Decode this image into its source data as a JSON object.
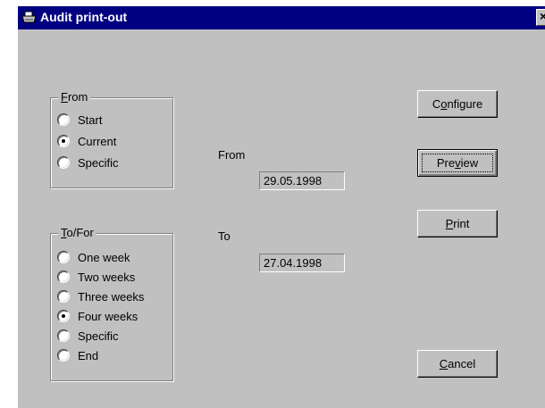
{
  "window": {
    "title": "Audit print-out",
    "icon": "printer-icon",
    "close_glyph": "×"
  },
  "from_group": {
    "legend_accel": "F",
    "legend_rest": "rom",
    "options": [
      {
        "label": "Start",
        "checked": false
      },
      {
        "label": "Current",
        "checked": true
      },
      {
        "label": "Specific",
        "checked": false
      }
    ]
  },
  "to_group": {
    "legend_accel": "T",
    "legend_rest": "o/For",
    "options": [
      {
        "label": "One week",
        "checked": false
      },
      {
        "label": "Two weeks",
        "checked": false
      },
      {
        "label": "Three weeks",
        "checked": false
      },
      {
        "label": "Four weeks",
        "checked": true
      },
      {
        "label": "Specific",
        "checked": false
      },
      {
        "label": "End",
        "checked": false
      }
    ]
  },
  "dates": {
    "from_label": "From",
    "from_value": "29.05.1998",
    "to_label": "To",
    "to_value": "27.04.1998"
  },
  "buttons": {
    "configure": {
      "pre": "C",
      "accel": "o",
      "post": "nfigure"
    },
    "preview": {
      "pre": "Pre",
      "accel": "v",
      "post": "iew"
    },
    "print": {
      "pre": "",
      "accel": "P",
      "post": "rint"
    },
    "cancel": {
      "pre": "",
      "accel": "C",
      "post": "ancel"
    }
  },
  "colors": {
    "titlebar": "#000080",
    "face": "#c0c0c0"
  }
}
